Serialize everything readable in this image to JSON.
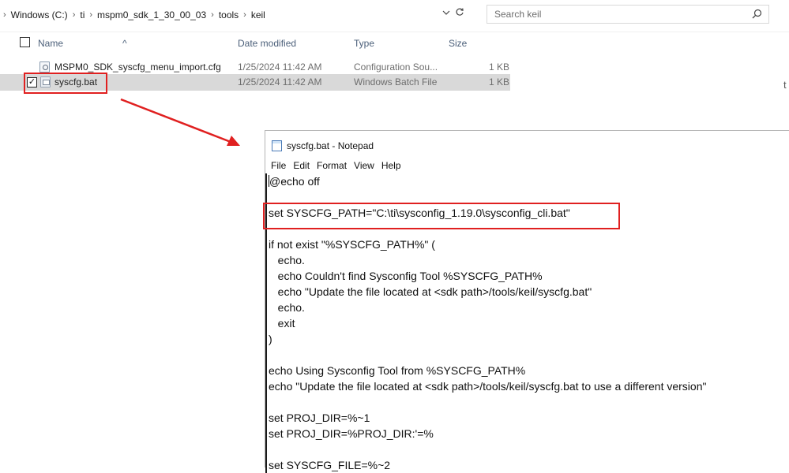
{
  "explorer": {
    "breadcrumb": [
      "Windows (C:)",
      "ti",
      "mspm0_sdk_1_30_00_03",
      "tools",
      "keil"
    ],
    "breadcrumb_lead_sep": "›",
    "sep": "›",
    "search_placeholder": "Search keil",
    "columns": {
      "name": "Name",
      "date": "Date modified",
      "type": "Type",
      "size": "Size"
    },
    "files": [
      {
        "name": "MSPM0_SDK_syscfg_menu_import.cfg",
        "date": "1/25/2024 11:42 AM",
        "type": "Configuration Sou...",
        "size": "1 KB",
        "icon": "config-file-icon",
        "selected": false
      },
      {
        "name": "syscfg.bat",
        "date": "1/25/2024 11:42 AM",
        "type": "Windows Batch File",
        "size": "1 KB",
        "icon": "batch-file-icon",
        "selected": true
      }
    ],
    "stray_char": "t"
  },
  "notepad": {
    "title": "syscfg.bat - Notepad",
    "menu": [
      "File",
      "Edit",
      "Format",
      "View",
      "Help"
    ],
    "lines": [
      "@echo off",
      "",
      "set SYSCFG_PATH=\"C:\\ti\\sysconfig_1.19.0\\sysconfig_cli.bat\"",
      "",
      "if not exist \"%SYSCFG_PATH%\" (",
      "   echo.",
      "   echo Couldn't find Sysconfig Tool %SYSCFG_PATH%",
      "   echo \"Update the file located at <sdk path>/tools/keil/syscfg.bat\"",
      "   echo.",
      "   exit",
      ")",
      "",
      "echo Using Sysconfig Tool from %SYSCFG_PATH%",
      "echo \"Update the file located at <sdk path>/tools/keil/syscfg.bat to use a different version\"",
      "",
      "set PROJ_DIR=%~1",
      "set PROJ_DIR=%PROJ_DIR:'=%",
      "",
      "set SYSCFG_FILE=%~2"
    ]
  },
  "colors": {
    "highlight": "#e02020",
    "selected_row": "#d9d9d9",
    "header_text": "#4c607a"
  }
}
